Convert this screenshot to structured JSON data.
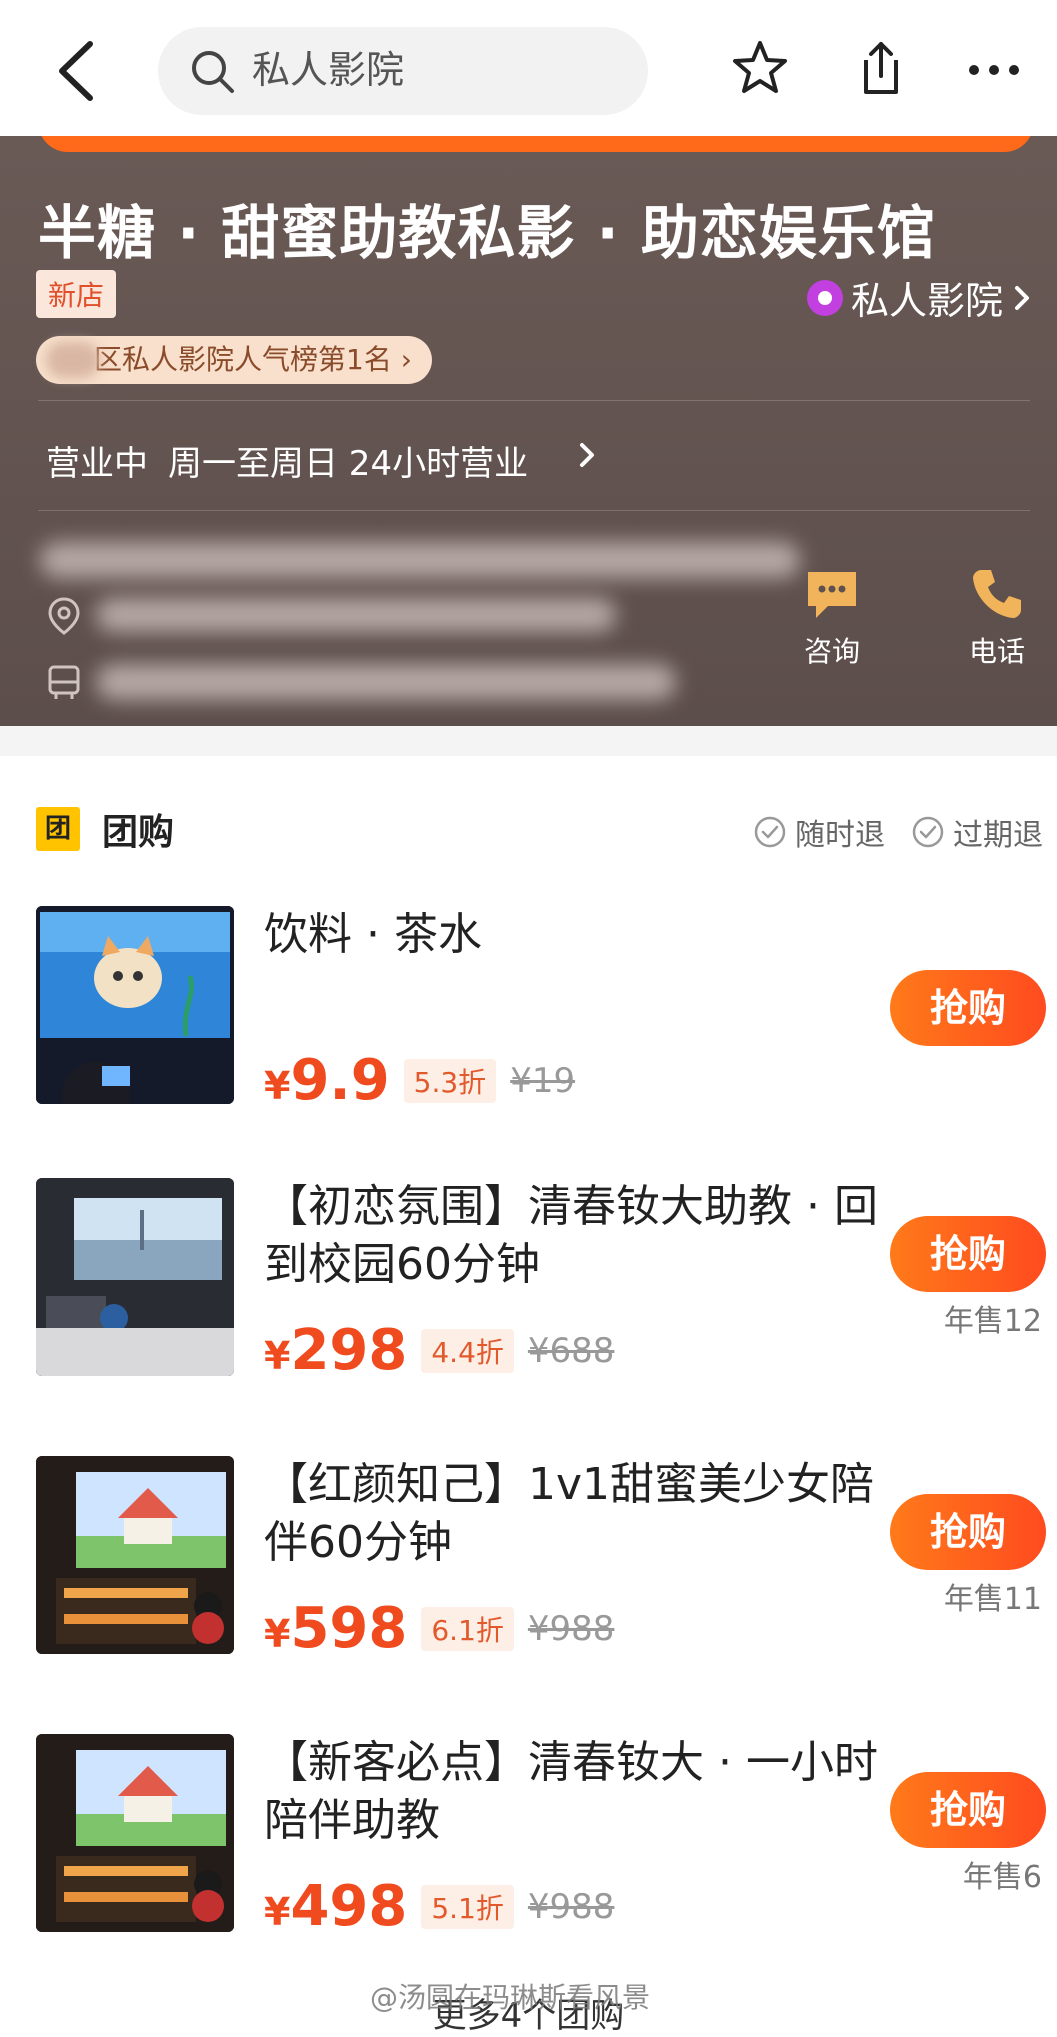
{
  "nav": {
    "search_placeholder": "私人影院"
  },
  "shop": {
    "name": "半糖 · 甜蜜助教私影 · 助恋娱乐馆",
    "new_badge": "新店",
    "category": "私人影院",
    "rank": "区私人影院人气榜第1名",
    "hours_status": "营业中",
    "hours": "周一至周日 24小时营业",
    "consult_label": "咨询",
    "phone_label": "电话"
  },
  "group": {
    "title": "团购",
    "icon_text": "团",
    "policies": [
      "随时退",
      "过期退"
    ],
    "more_label": "更多4个团购"
  },
  "deals": [
    {
      "title": "饮料 · 茶水",
      "price": "9.9",
      "discount": "5.3折",
      "original": "¥19",
      "sales": "",
      "buy": "抢购"
    },
    {
      "title": "【初恋氛围】清春钕大助教 · 回到校园60分钟",
      "price": "298",
      "discount": "4.4折",
      "original": "¥688",
      "sales": "年售12",
      "buy": "抢购"
    },
    {
      "title": "【红颜知己】1v1甜蜜美少女陪伴60分钟",
      "price": "598",
      "discount": "6.1折",
      "original": "¥988",
      "sales": "年售11",
      "buy": "抢购"
    },
    {
      "title": "【新客必点】清春钕大 · 一小时陪伴助教",
      "price": "498",
      "discount": "5.1折",
      "original": "¥988",
      "sales": "年售6",
      "buy": "抢购"
    }
  ],
  "currency": "¥",
  "watermark": "@汤圆在玛琳斯看风景",
  "colors": {
    "accent": "#ff5a1f",
    "price": "#f04a1f",
    "hero_bg": "#5f514e",
    "tuan_icon": "#ffc300"
  }
}
